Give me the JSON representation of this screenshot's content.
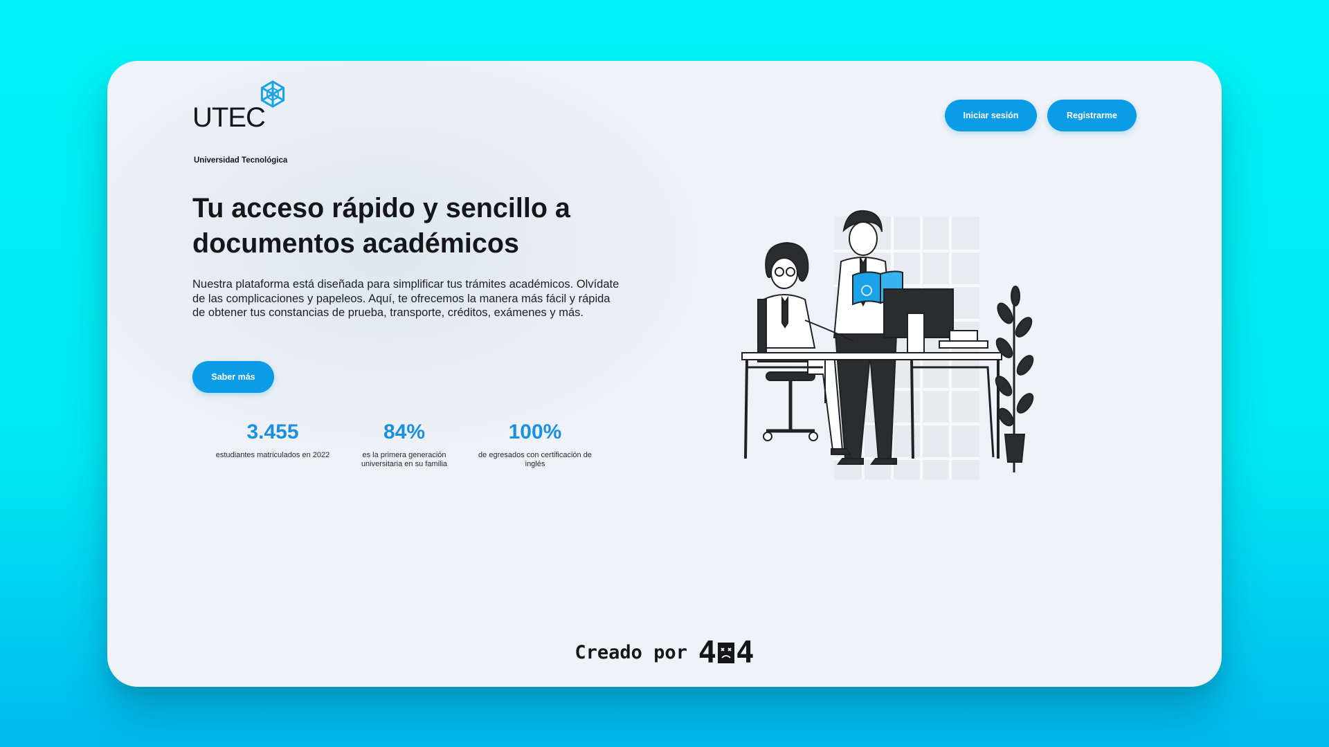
{
  "brand": {
    "name": "UTEC",
    "subtitle": "Universidad Tecnológica",
    "accent_color": "#0c9be6",
    "logo_icon": "snowflake-hexagon-icon"
  },
  "header": {
    "login_label": "Iniciar sesión",
    "register_label": "Registrarme"
  },
  "hero": {
    "title": "Tu acceso rápido y sencillo a documentos académicos",
    "description": "Nuestra plataforma está diseñada para simplificar tus trámites académicos. Olvídate de las complicaciones y papeleos. Aquí, te ofrecemos la manera más fácil y rápida de obtener tus constancias de prueba, transporte, créditos, exámenes y más.",
    "cta_label": "Saber más"
  },
  "stats": [
    {
      "value": "3.455",
      "label": "estudiantes matriculados en 2022"
    },
    {
      "value": "84%",
      "label": "es la primera generación universitaria en su familia"
    },
    {
      "value": "100%",
      "label": "de egresados con certificación de inglés"
    }
  ],
  "illustration": {
    "icon": "office-workers-illustration"
  },
  "footer": {
    "credit_text": "Creado por",
    "credit_brand": "404"
  }
}
